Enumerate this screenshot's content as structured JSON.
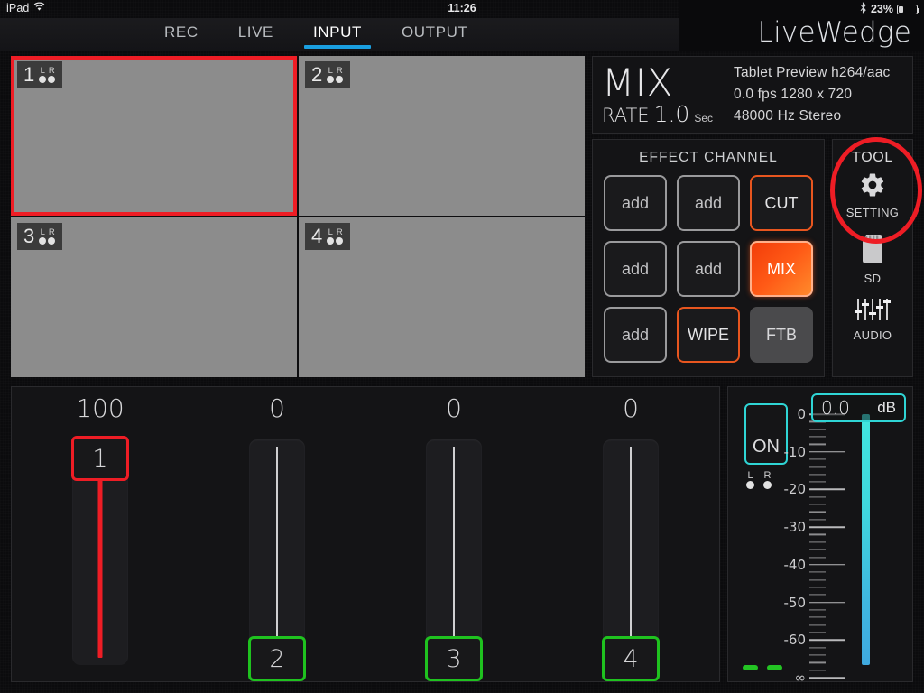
{
  "status_bar": {
    "device": "iPad",
    "wifi_icon": "wifi-icon",
    "clock": "11:26",
    "bluetooth_icon": "bluetooth-icon",
    "battery_percent": "23%",
    "battery_level": 23
  },
  "header": {
    "brand": "LiveWedge",
    "tabs": [
      {
        "label": "REC",
        "active": false
      },
      {
        "label": "LIVE",
        "active": false
      },
      {
        "label": "INPUT",
        "active": true
      },
      {
        "label": "OUTPUT",
        "active": false
      }
    ],
    "active_tab_color": "#1a9fe0"
  },
  "preview_grid": {
    "cells": [
      {
        "number": "1",
        "left_label": "L",
        "right_label": "R",
        "selected": true
      },
      {
        "number": "2",
        "left_label": "L",
        "right_label": "R",
        "selected": false
      },
      {
        "number": "3",
        "left_label": "L",
        "right_label": "R",
        "selected": false
      },
      {
        "number": "4",
        "left_label": "L",
        "right_label": "R",
        "selected": false
      }
    ],
    "selection_color": "#ee1d25"
  },
  "info_panel": {
    "mix_label": "MIX",
    "rate_label": "RATE",
    "rate_value": "1.0",
    "rate_unit": "Sec",
    "line1": "Tablet Preview h264/aac",
    "line2": "0.0  fps  1280 x 720",
    "line3": "48000 Hz  Stereo"
  },
  "effect_channel": {
    "title": "EFFECT CHANNEL",
    "buttons": [
      {
        "label": "add",
        "style": "add"
      },
      {
        "label": "add",
        "style": "add"
      },
      {
        "label": "CUT",
        "style": "outline-orange"
      },
      {
        "label": "add",
        "style": "add"
      },
      {
        "label": "add",
        "style": "add"
      },
      {
        "label": "MIX",
        "style": "filled-orange"
      },
      {
        "label": "add",
        "style": "add"
      },
      {
        "label": "WIPE",
        "style": "outline-orange"
      },
      {
        "label": "FTB",
        "style": "filled-gray"
      }
    ],
    "active_color": "#ff5a16"
  },
  "tool_panel": {
    "title": "TOOL",
    "items": [
      {
        "label": "SETTING",
        "icon": "gear-icon",
        "highlighted": true
      },
      {
        "label": "SD",
        "icon": "sd-card-icon",
        "highlighted": false
      },
      {
        "label": "AUDIO",
        "icon": "audio-sliders-icon",
        "highlighted": false
      }
    ],
    "highlight_color": "#ee1d25"
  },
  "faders": {
    "channels": [
      {
        "value": "100",
        "handle_label": "1",
        "position": "top",
        "state": "active",
        "color": "#ee1d25"
      },
      {
        "value": "0",
        "handle_label": "2",
        "position": "bottom",
        "state": "inactive",
        "color": "#1fc21f"
      },
      {
        "value": "0",
        "handle_label": "3",
        "position": "bottom",
        "state": "inactive",
        "color": "#1fc21f"
      },
      {
        "value": "0",
        "handle_label": "4",
        "position": "bottom",
        "state": "inactive",
        "color": "#1fc21f"
      }
    ]
  },
  "audio_meter": {
    "on_button_label": "ON",
    "left_label": "L",
    "right_label": "R",
    "db_value": "0.0",
    "db_unit": "dB",
    "accent_color": "#2fd5d5",
    "scale_labels": [
      "0",
      "-10",
      "-20",
      "-30",
      "-40",
      "-50",
      "-60",
      "∞"
    ],
    "level_pips": 2
  }
}
